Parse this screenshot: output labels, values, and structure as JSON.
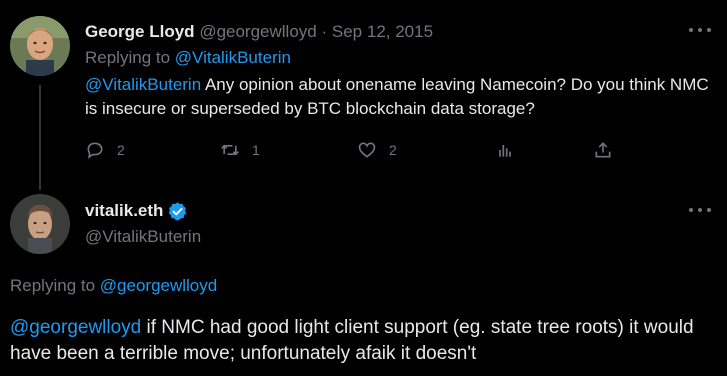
{
  "parent_tweet": {
    "author_name": "George Lloyd",
    "author_handle": "@georgewlloyd",
    "separator": "·",
    "date": "Sep 12, 2015",
    "replying_prefix": "Replying to ",
    "replying_handle": "@VitalikButerin",
    "body_mention": "@VitalikButerin",
    "body_text": " Any opinion about onename leaving Namecoin? Do you think NMC is insecure or superseded by BTC blockchain data storage?",
    "actions": {
      "reply_count": "2",
      "retweet_count": "1",
      "like_count": "2"
    }
  },
  "main_tweet": {
    "author_name": "vitalik.eth",
    "author_handle": "@VitalikButerin",
    "verified": true,
    "replying_prefix": "Replying to ",
    "replying_handle": "@georgewlloyd",
    "body_mention": "@georgewlloyd",
    "body_text": " if NMC had good light client support (eg. state tree roots) it would have been a terrible move; unfortunately afaik it doesn't"
  },
  "colors": {
    "background": "#000000",
    "text": "#e7e9ea",
    "muted": "#71767b",
    "accent": "#1d9bf0"
  },
  "icons": [
    "reply-icon",
    "retweet-icon",
    "like-icon",
    "views-icon",
    "share-icon",
    "more-icon",
    "verified-badge-icon"
  ]
}
